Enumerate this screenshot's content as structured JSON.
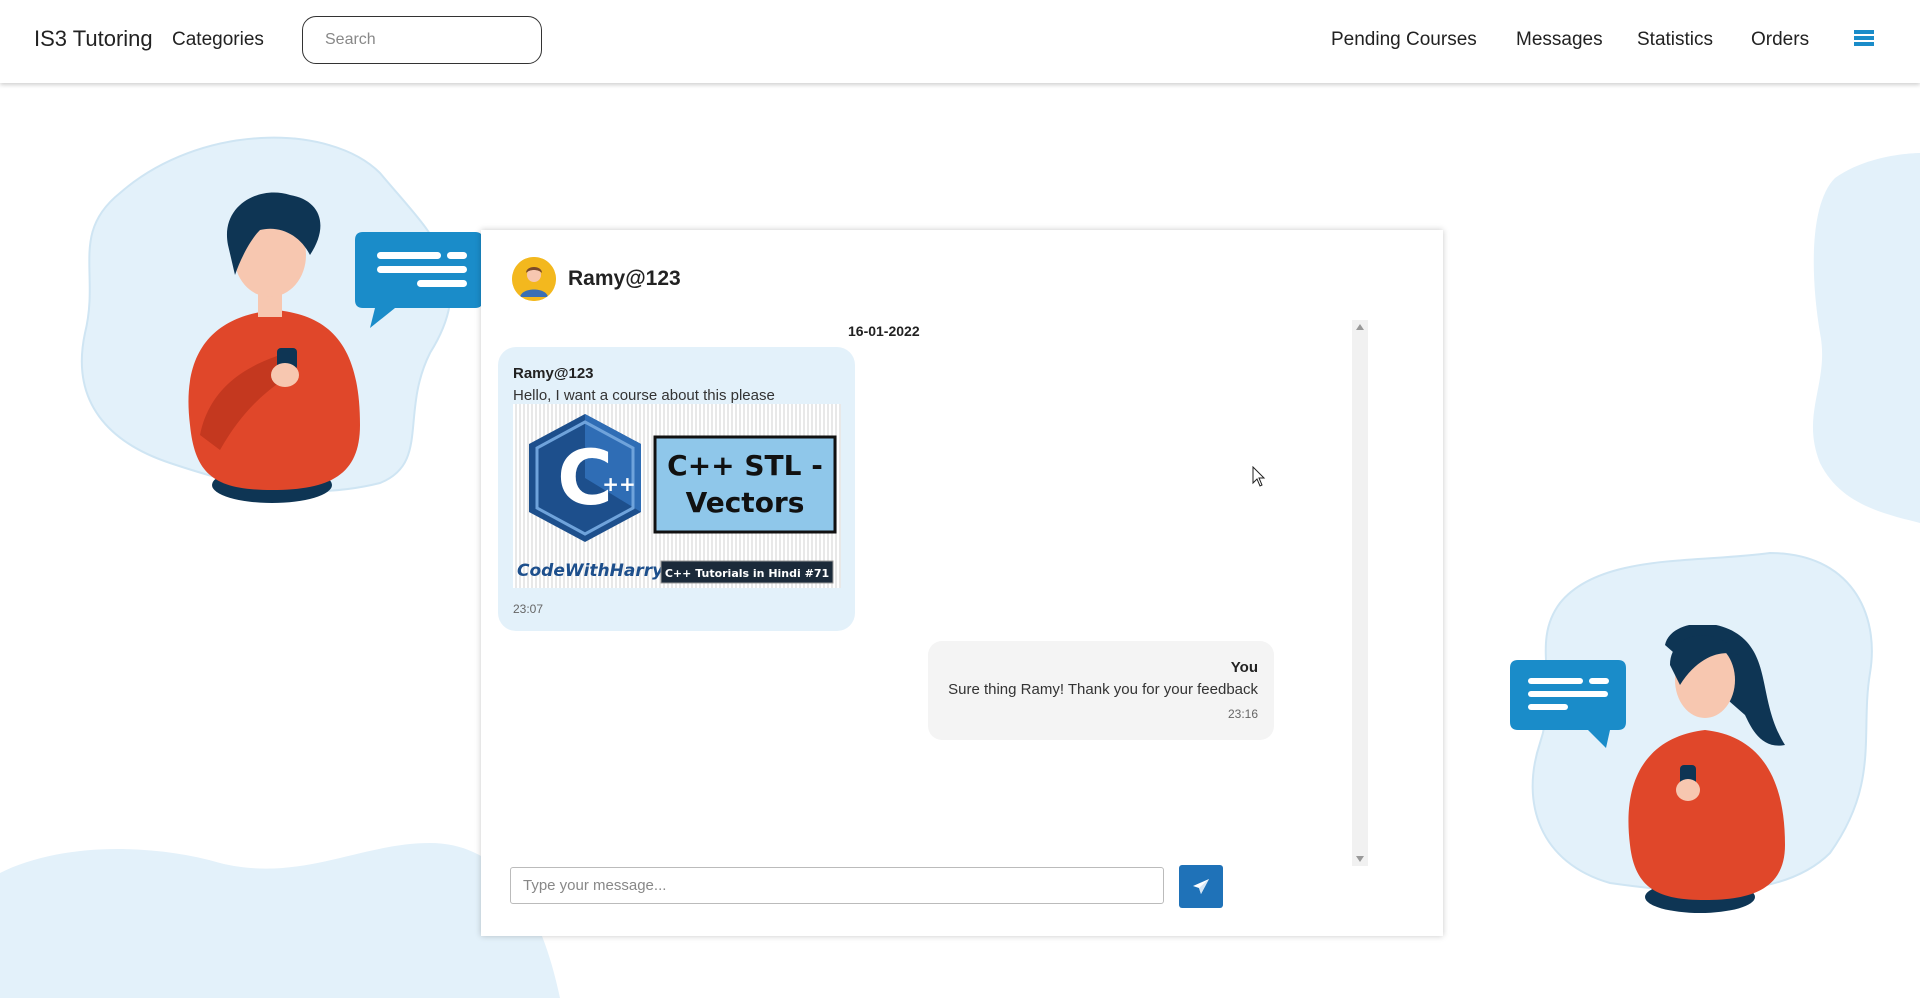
{
  "navbar": {
    "brand": "IS3 Tutoring",
    "categories": "Categories",
    "search_placeholder": "Search",
    "links": [
      "Pending Courses",
      "Messages",
      "Statistics",
      "Orders"
    ]
  },
  "chat": {
    "contact_name": "Ramy@123",
    "date": "16-01-2022",
    "incoming": {
      "sender": "Ramy@123",
      "text": "Hello, I want a course about this please",
      "time": "23:07",
      "image": {
        "logo_text": "C",
        "logo_plus": "++",
        "title_line1": "C++ STL -",
        "title_line2": "Vectors",
        "channel": "CodeWithHarry",
        "series": "C++ Tutorials in Hindi #71"
      }
    },
    "outgoing": {
      "sender": "You",
      "text": "Sure thing Ramy! Thank you for your feedback",
      "time": "23:16"
    },
    "input_placeholder": "Type your message..."
  },
  "colors": {
    "accent": "#1a8cc9",
    "send_button": "#1f72b8",
    "incoming_bubble": "#e3f1fa",
    "outgoing_bubble": "#f4f4f4",
    "blob": "#e3f1fa",
    "figure_shirt": "#e0472a",
    "figure_hair": "#0e3554"
  },
  "icons": {
    "menu": "list-icon",
    "send": "paper-plane-icon",
    "speech": "speech-bubble-icon"
  }
}
